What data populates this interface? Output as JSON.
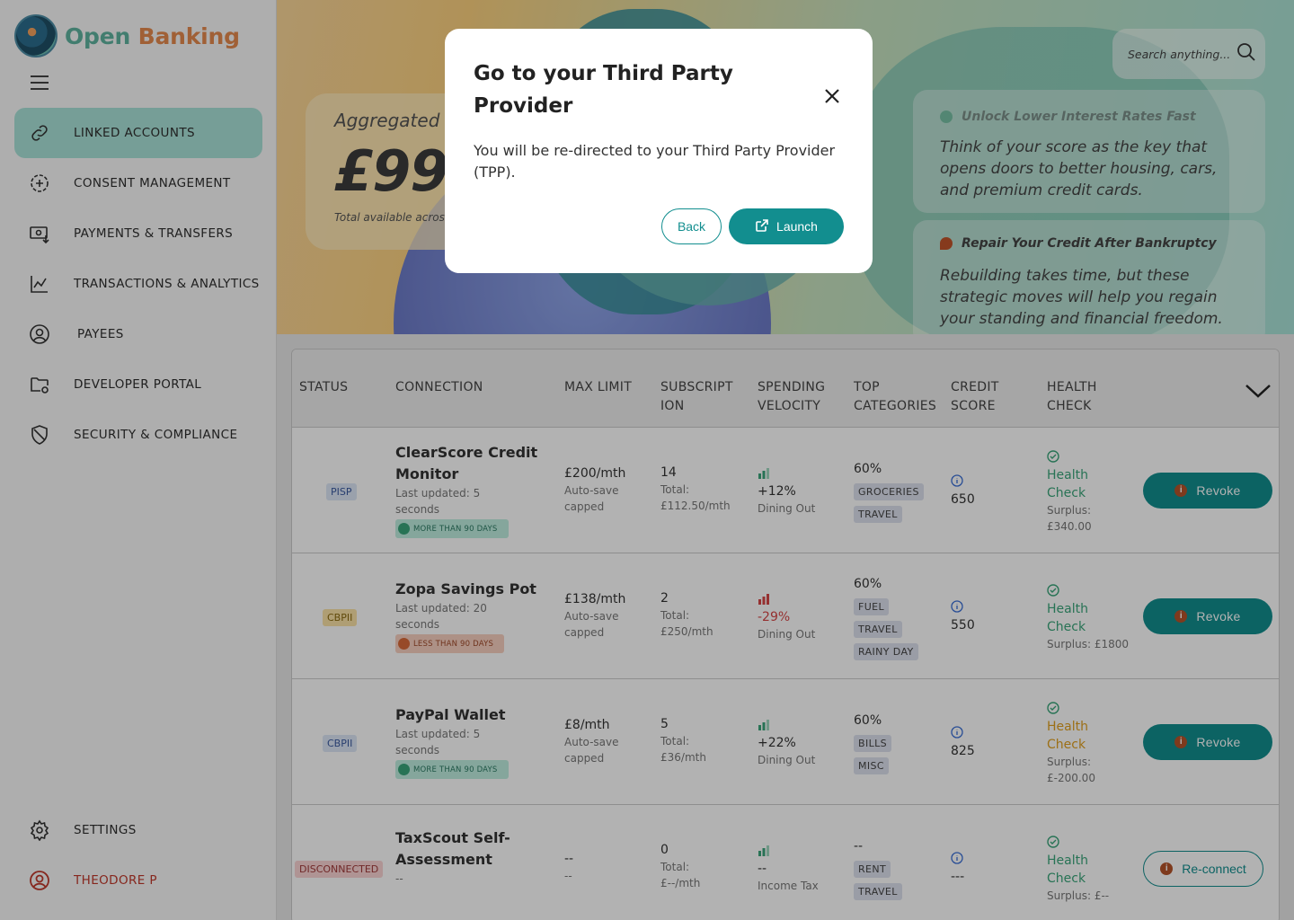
{
  "brand": {
    "part1": "Open",
    "part2": "Banking"
  },
  "nav": {
    "items": [
      {
        "label": "LINKED ACCOUNTS",
        "icon": "link-icon",
        "active": true
      },
      {
        "label": "CONSENT MANAGEMENT",
        "icon": "plus-circle-icon"
      },
      {
        "label": "PAYMENTS & TRANSFERS",
        "icon": "payment-icon"
      },
      {
        "label": "TRANSACTIONS & ANALYTICS",
        "icon": "chart-line-icon"
      },
      {
        "label": "PAYEES",
        "icon": "user-circle-icon"
      },
      {
        "label": "DEVELOPER PORTAL",
        "icon": "folder-icon"
      },
      {
        "label": "SECURITY & COMPLIANCE",
        "icon": "shield-icon"
      }
    ],
    "settings": "SETTINGS",
    "user": "THEODORE P"
  },
  "hero": {
    "agg_title": "Aggregated",
    "agg_amount": "£99",
    "agg_sub": "Total available acros",
    "search_placeholder": "Search anything...",
    "tip1": {
      "title": "Unlock Lower Interest Rates Fast",
      "body": "Think of your score as the key that opens doors to better housing, cars, and premium credit cards."
    },
    "tip2": {
      "title": "Repair Your Credit After Bankruptcy",
      "body": "Rebuilding takes time, but these strategic moves will help you regain your standing and financial freedom."
    }
  },
  "table": {
    "headers": {
      "status": "STATUS",
      "connection": "CONNECTION",
      "max_limit": "MAX LIMIT",
      "subscription": "SUBSCRIPT ION",
      "velocity": "SPENDING VELOCITY",
      "categories": "TOP CATEGORIES",
      "credit": "CREDIT SCORE",
      "health": "HEALTH CHECK"
    },
    "rows": [
      {
        "status": "PISP",
        "name1": "ClearScore Credit",
        "name2": "Monitor",
        "updated1": "Last updated: 5",
        "updated2": "seconds",
        "days": "MORE THAN 90 DAYS",
        "limit": "£200/mth",
        "limit_note1": "Auto-save",
        "limit_note2": "capped",
        "subs": "14",
        "subs_total1": "Total:",
        "subs_total2": "£112.50/mth",
        "velocity": "+12%",
        "velocity_note": "Dining Out",
        "cat_pct": "60%",
        "cats": [
          "GROCERIES",
          "TRAVEL"
        ],
        "credit": "650",
        "health1": "Health",
        "health2": "Check",
        "surplus1": "Surplus:",
        "surplus2": "£340.00",
        "action": "Revoke"
      },
      {
        "status": "CBPII",
        "name1": "Zopa Savings Pot",
        "updated1": "Last updated: 20",
        "updated2": "seconds",
        "days": "LESS THAN 90 DAYS",
        "limit": "£138/mth",
        "limit_note1": "Auto-save",
        "limit_note2": "capped",
        "subs": "2",
        "subs_total1": "Total:",
        "subs_total2": "£250/mth",
        "velocity": "-29%",
        "velocity_note": "Dining Out",
        "cat_pct": "60%",
        "cats": [
          "FUEL",
          "TRAVEL",
          "RAINY DAY"
        ],
        "credit": "550",
        "health1": "Health",
        "health2": "Check",
        "surplus1": "Surplus: £1800",
        "action": "Revoke"
      },
      {
        "status": "CBPII",
        "name1": "PayPal Wallet",
        "updated1": "Last updated: 5",
        "updated2": "seconds",
        "days": "MORE THAN 90 DAYS",
        "limit": "£8/mth",
        "limit_note1": "Auto-save",
        "limit_note2": "capped",
        "subs": "5",
        "subs_total1": "Total:",
        "subs_total2": "£36/mth",
        "velocity": "+22%",
        "velocity_note": "Dining Out",
        "cat_pct": "60%",
        "cats": [
          "BILLS",
          "MISC"
        ],
        "credit": "825",
        "health1": "Health",
        "health2": "Check",
        "surplus1": "Surplus:",
        "surplus2": "£-200.00",
        "action": "Revoke"
      },
      {
        "status": "DISCONNECTED",
        "name1": "TaxScout Self-",
        "name2": "Assessment",
        "updated1": "--",
        "limit": "--",
        "limit_note1": "--",
        "subs": "0",
        "subs_total1": "Total:",
        "subs_total2": "£--/mth",
        "velocity": "--",
        "velocity_note": "Income Tax",
        "cat_pct": "--",
        "cats": [
          "RENT",
          "TRAVEL"
        ],
        "credit": "---",
        "health1": "Health",
        "health2": "Check",
        "surplus1": "Surplus: £--",
        "action": "Re-connect"
      }
    ]
  },
  "modal": {
    "title": "Go to your Third Party Provider",
    "body": "You will be re-directed to your Third Party Provider (TPP).",
    "back": "Back",
    "launch": "Launch"
  },
  "colors": {
    "accent": "#128e8f",
    "active_nav": "#a9e3d8",
    "danger": "#d64545",
    "positive": "#3aa57a"
  }
}
